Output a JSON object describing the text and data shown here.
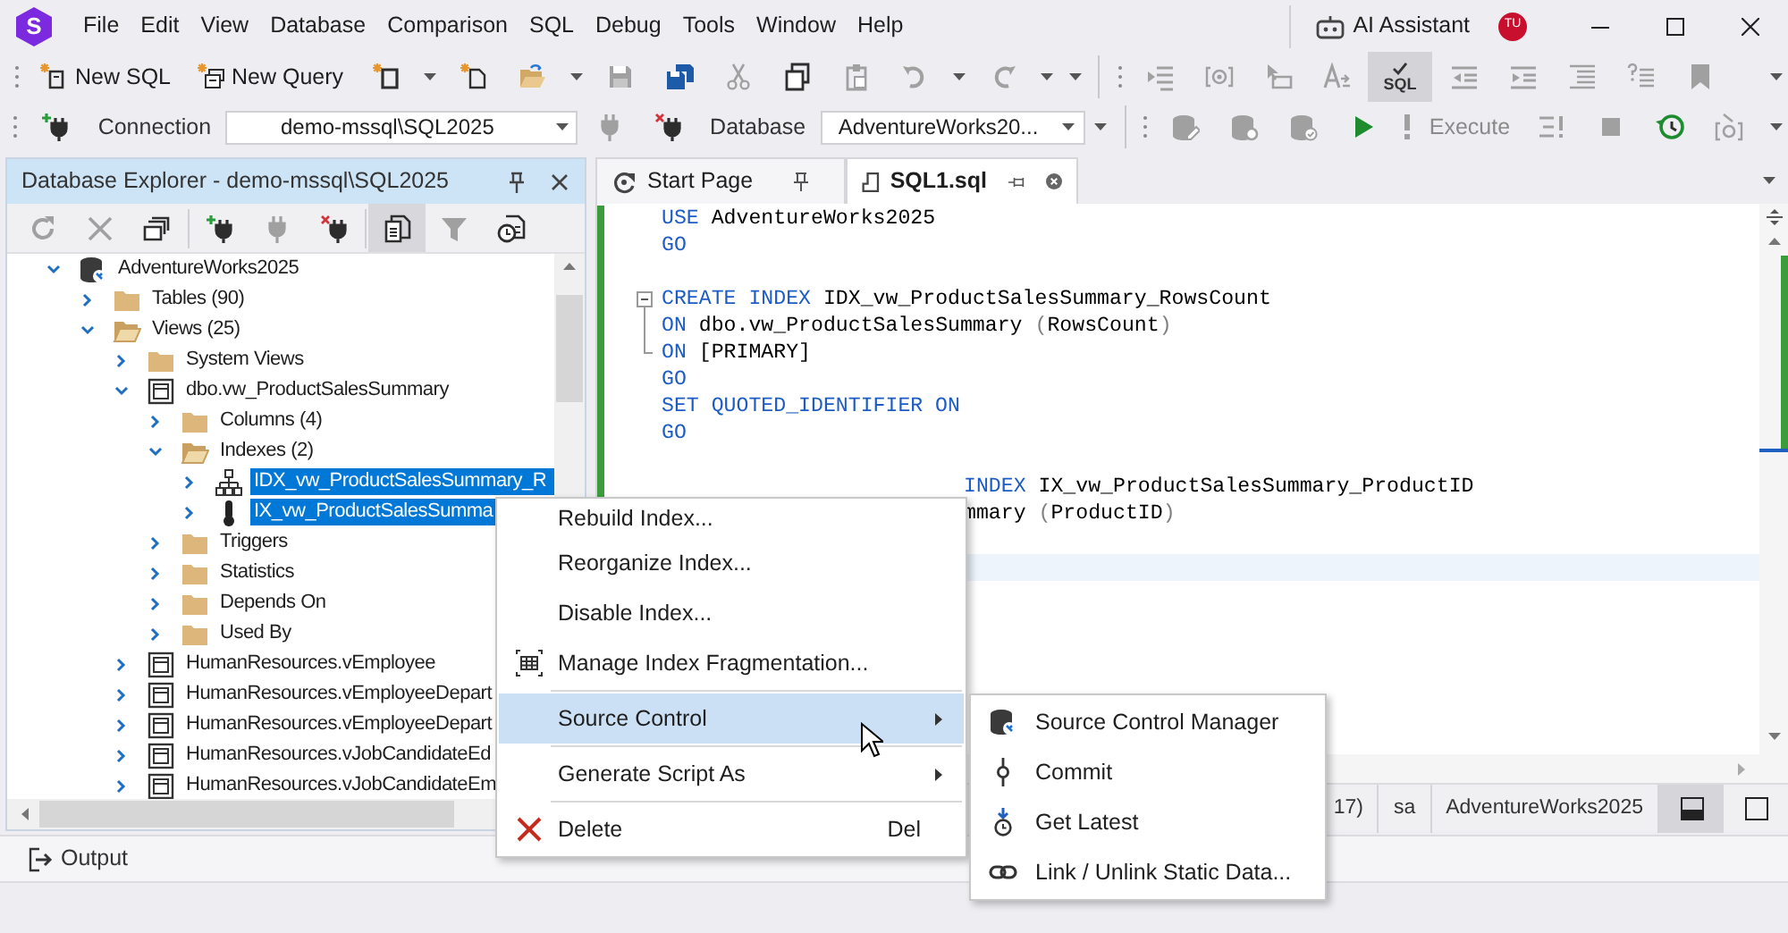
{
  "title_bar": {
    "logo": "S",
    "menu": [
      "File",
      "Edit",
      "View",
      "Database",
      "Comparison",
      "SQL",
      "Debug",
      "Tools",
      "Window",
      "Help"
    ],
    "ai_assistant": "AI Assistant",
    "avatar": "TU"
  },
  "toolbar_1": [
    {
      "kind": "grip"
    },
    {
      "kind": "button",
      "label": "New SQL",
      "disabled": false
    },
    {
      "kind": "button",
      "label": "New Query",
      "disabled": false
    },
    {
      "kind": "icon",
      "disabled": false
    },
    {
      "kind": "dropdown"
    },
    {
      "kind": "icon",
      "disabled": false
    },
    {
      "kind": "icon",
      "disabled": false
    },
    {
      "kind": "dropdown"
    },
    {
      "kind": "icon",
      "disabled": true
    },
    {
      "kind": "icon",
      "disabled": false
    },
    {
      "kind": "icon",
      "disabled": true
    },
    {
      "kind": "icon",
      "disabled": false
    },
    {
      "kind": "icon",
      "disabled": true
    },
    {
      "kind": "icon",
      "disabled": true
    },
    {
      "kind": "dropdown"
    },
    {
      "kind": "icon",
      "disabled": true
    },
    {
      "kind": "dropdown"
    },
    {
      "kind": "dropdown"
    },
    {
      "kind": "separator"
    },
    {
      "kind": "grip"
    },
    {
      "kind": "icon",
      "disabled": true
    },
    {
      "kind": "icon",
      "disabled": true
    },
    {
      "kind": "icon",
      "disabled": true
    },
    {
      "kind": "icon",
      "disabled": true
    },
    {
      "kind": "toggle",
      "label": "SQL",
      "selected": true
    },
    {
      "kind": "icon",
      "disabled": true
    },
    {
      "kind": "icon",
      "disabled": true
    },
    {
      "kind": "icon",
      "disabled": true
    },
    {
      "kind": "icon",
      "disabled": true
    },
    {
      "kind": "icon",
      "disabled": true
    },
    {
      "kind": "spacer"
    },
    {
      "kind": "dropdown"
    }
  ],
  "toolbar_2": [
    {
      "kind": "grip"
    },
    {
      "kind": "icon",
      "disabled": false
    },
    {
      "kind": "label",
      "label": "Connection"
    },
    {
      "kind": "combo",
      "value": "demo-mssql\\SQL2025"
    },
    {
      "kind": "icon",
      "disabled": true
    },
    {
      "kind": "icon",
      "disabled": false
    },
    {
      "kind": "label",
      "label": "Database"
    },
    {
      "kind": "combo",
      "value": "AdventureWorks20..."
    },
    {
      "kind": "dropdown"
    },
    {
      "kind": "separator"
    },
    {
      "kind": "grip"
    },
    {
      "kind": "icon",
      "disabled": true
    },
    {
      "kind": "icon",
      "disabled": true
    },
    {
      "kind": "icon",
      "disabled": true
    },
    {
      "kind": "icon",
      "disabled": false
    },
    {
      "kind": "button",
      "label": "Execute",
      "disabled": true
    },
    {
      "kind": "icon",
      "disabled": true
    },
    {
      "kind": "icon",
      "disabled": true
    },
    {
      "kind": "icon",
      "disabled": false
    },
    {
      "kind": "icon",
      "disabled": true
    },
    {
      "kind": "spacer"
    },
    {
      "kind": "dropdown"
    }
  ],
  "database_explorer": {
    "title": "Database Explorer - demo-mssql\\SQL2025",
    "toolbar": [
      {
        "disabled": true,
        "selected": false
      },
      {
        "disabled": true,
        "selected": false
      },
      {
        "disabled": false,
        "selected": false
      },
      {
        "disabled": false,
        "selected": false
      },
      {
        "disabled": true,
        "selected": false
      },
      {
        "disabled": false,
        "selected": false
      },
      {
        "disabled": false,
        "selected": true
      },
      {
        "disabled": true,
        "selected": false
      },
      {
        "disabled": false,
        "selected": false
      }
    ],
    "tree": [
      {
        "label": "AdventureWorks2025",
        "kind": "database",
        "expanded": true,
        "selected": false,
        "children": [
          {
            "label": "Tables (90)",
            "kind": "folder",
            "expanded": false,
            "selected": false
          },
          {
            "label": "Views (25)",
            "kind": "folder",
            "expanded": true,
            "selected": false,
            "children": [
              {
                "label": "System Views",
                "kind": "folder",
                "expanded": false,
                "selected": false
              },
              {
                "label": "dbo.vw_ProductSalesSummary",
                "kind": "view",
                "expanded": true,
                "selected": false,
                "children": [
                  {
                    "label": "Columns (4)",
                    "kind": "folder",
                    "expanded": false,
                    "selected": false
                  },
                  {
                    "label": "Indexes (2)",
                    "kind": "folder",
                    "expanded": true,
                    "selected": false,
                    "children": [
                      {
                        "label": "IDX_vw_ProductSalesSummary_R",
                        "kind": "index",
                        "expanded": false,
                        "selected": true
                      },
                      {
                        "label": "IX_vw_ProductSalesSumma",
                        "kind": "clustered_index",
                        "expanded": false,
                        "selected": true
                      }
                    ]
                  },
                  {
                    "label": "Triggers",
                    "kind": "folder",
                    "expanded": false,
                    "selected": false
                  },
                  {
                    "label": "Statistics",
                    "kind": "folder",
                    "expanded": false,
                    "selected": false
                  },
                  {
                    "label": "Depends On",
                    "kind": "folder",
                    "expanded": false,
                    "selected": false
                  },
                  {
                    "label": "Used By",
                    "kind": "folder",
                    "expanded": false,
                    "selected": false
                  }
                ]
              },
              {
                "label": "HumanResources.vEmployee",
                "kind": "view",
                "expanded": false,
                "selected": false
              },
              {
                "label": "HumanResources.vEmployeeDepart",
                "kind": "view",
                "expanded": false,
                "selected": false
              },
              {
                "label": "HumanResources.vEmployeeDepart",
                "kind": "view",
                "expanded": false,
                "selected": false
              },
              {
                "label": "HumanResources.vJobCandidateEd",
                "kind": "view",
                "expanded": false,
                "selected": false
              },
              {
                "label": "HumanResources.vJobCandidateEm",
                "kind": "view",
                "expanded": false,
                "selected": false
              }
            ]
          }
        ]
      }
    ]
  },
  "editor": {
    "tabs": [
      {
        "label": "Start Page",
        "selected": false
      },
      {
        "label": "SQL1.sql",
        "selected": true
      }
    ],
    "lines": [
      {
        "kind": "code",
        "tokens": [
          {
            "kind": "keyword",
            "text": "USE "
          },
          {
            "kind": "plain",
            "text": "AdventureWorks2025"
          }
        ]
      },
      {
        "kind": "code",
        "tokens": [
          {
            "kind": "keyword",
            "text": "GO"
          }
        ]
      },
      {
        "kind": "blank",
        "current": false
      },
      {
        "kind": "code",
        "fold_start": true,
        "tokens": [
          {
            "kind": "keyword",
            "text": "CREATE INDEX "
          },
          {
            "kind": "plain",
            "text": "IDX_vw_ProductSalesSummary_RowsCount"
          }
        ]
      },
      {
        "kind": "code",
        "fold_body": true,
        "tokens": [
          {
            "kind": "keyword",
            "text": "ON "
          },
          {
            "kind": "plain",
            "text": "dbo.vw_ProductSalesSummary "
          },
          {
            "kind": "punct",
            "text": "("
          },
          {
            "kind": "plain",
            "text": "RowsCount"
          },
          {
            "kind": "punct",
            "text": ")"
          }
        ]
      },
      {
        "kind": "code",
        "fold_end": true,
        "tokens": [
          {
            "kind": "keyword",
            "text": "ON "
          },
          {
            "kind": "plain",
            "text": "[PRIMARY]"
          }
        ]
      },
      {
        "kind": "code",
        "tokens": [
          {
            "kind": "keyword",
            "text": "GO"
          }
        ]
      },
      {
        "kind": "code",
        "tokens": [
          {
            "kind": "keyword",
            "text": "SET QUOTED_IDENTIFIER ON"
          }
        ]
      },
      {
        "kind": "code",
        "tokens": [
          {
            "kind": "keyword",
            "text": "GO"
          }
        ]
      },
      {
        "kind": "blank",
        "current": false
      },
      {
        "kind": "covered",
        "tokens": [
          {
            "kind": "keyword",
            "text": "INDEX "
          },
          {
            "kind": "plain",
            "text": "IX_vw_ProductSalesSummary_ProductID"
          }
        ]
      },
      {
        "kind": "covered",
        "tokens": [
          {
            "kind": "plain",
            "text": "mmary "
          },
          {
            "kind": "punct",
            "text": "("
          },
          {
            "kind": "plain",
            "text": "ProductID"
          },
          {
            "kind": "punct",
            "text": ")"
          }
        ]
      },
      {
        "kind": "blank",
        "current": false
      },
      {
        "kind": "blank",
        "current": true
      }
    ],
    "status": [
      "17)",
      "sa",
      "AdventureWorks2025"
    ],
    "layout_buttons": [
      {
        "selected": true
      },
      {
        "selected": false
      }
    ]
  },
  "output": {
    "label": "Output"
  },
  "context_menu": {
    "items": [
      {
        "kind": "item",
        "label": "Rebuild Index...",
        "selected": false,
        "submenu": false
      },
      {
        "kind": "item",
        "label": "Reorganize Index...",
        "selected": false,
        "submenu": false
      },
      {
        "kind": "item",
        "label": "Disable Index...",
        "selected": false,
        "submenu": false
      },
      {
        "kind": "item",
        "label": "Manage Index Fragmentation...",
        "selected": false,
        "submenu": false
      },
      {
        "kind": "separator"
      },
      {
        "kind": "item",
        "label": "Source Control",
        "selected": true,
        "submenu": true
      },
      {
        "kind": "separator"
      },
      {
        "kind": "item",
        "label": "Generate Script As",
        "selected": false,
        "submenu": true
      },
      {
        "kind": "separator"
      },
      {
        "kind": "item",
        "label": "Delete",
        "shortcut": "Del",
        "selected": false,
        "submenu": false
      }
    ]
  },
  "submenu": {
    "items": [
      {
        "label": "Source Control Manager",
        "selected": false
      },
      {
        "label": "Commit",
        "selected": false
      },
      {
        "label": "Get Latest",
        "selected": false
      },
      {
        "label": "Link / Unlink Static Data...",
        "selected": false
      }
    ]
  }
}
